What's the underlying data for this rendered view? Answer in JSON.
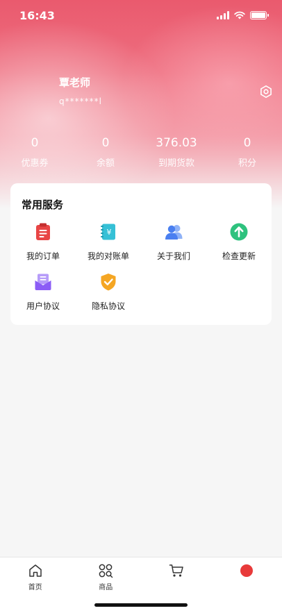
{
  "status_bar": {
    "time": "16:43"
  },
  "profile": {
    "name": "覃老师",
    "account": "q*******l"
  },
  "stats": [
    {
      "value": "0",
      "label": "优惠券"
    },
    {
      "value": "0",
      "label": "余额"
    },
    {
      "value": "376.03",
      "label": "到期货款"
    },
    {
      "value": "0",
      "label": "积分"
    }
  ],
  "services": {
    "title": "常用服务",
    "items": [
      {
        "label": "我的订单",
        "icon": "order-icon",
        "color": "#e84545"
      },
      {
        "label": "我的对账单",
        "icon": "statement-icon",
        "color": "#35c0d6"
      },
      {
        "label": "关于我们",
        "icon": "users-icon",
        "color": "#4a7ff0"
      },
      {
        "label": "检查更新",
        "icon": "update-icon",
        "color": "#2ec27e"
      },
      {
        "label": "用户协议",
        "icon": "agreement-icon",
        "color": "#8b5cf6"
      },
      {
        "label": "隐私协议",
        "icon": "privacy-shield-icon",
        "color": "#f5a623"
      }
    ]
  },
  "tabbar": {
    "items": [
      {
        "label": "首页",
        "icon": "home-icon"
      },
      {
        "label": "商品",
        "icon": "grid-icon"
      },
      {
        "label": "",
        "icon": "cart-icon"
      },
      {
        "label": "",
        "icon": "profile-icon"
      }
    ]
  },
  "colors": {
    "header": "#ea5a6e",
    "background": "#f6f6f6",
    "accent": "#e83a3a"
  }
}
